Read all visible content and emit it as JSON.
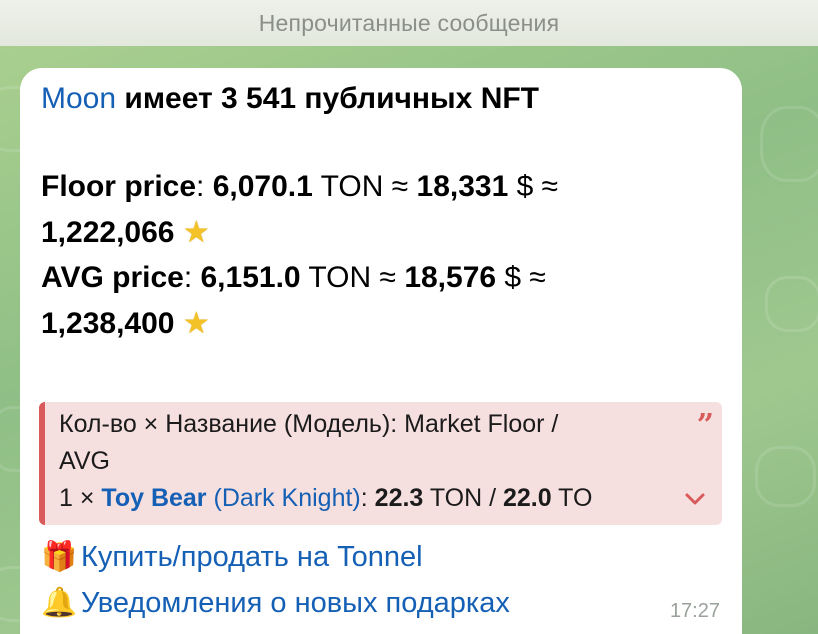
{
  "header": {
    "title": "Непрочитанные сообщения"
  },
  "message": {
    "line1": {
      "name": "Moon",
      "text": " имеет 3 541 публичных NFT"
    },
    "floor": {
      "label": "Floor price",
      "colon": ": ",
      "ton_value": "6,070.1",
      "ton_unit": " TON ≈ ",
      "usd_value": "18,331",
      "usd_unit": " $ ≈",
      "stars_value": "1,222,066"
    },
    "avg": {
      "label": "AVG price",
      "colon": ": ",
      "ton_value": "6,151.0",
      "ton_unit": " TON ≈ ",
      "usd_value": "18,576",
      "usd_unit": " $ ≈",
      "stars_value": "1,238,400"
    },
    "star_glyph": "★",
    "quote": {
      "header_line1": "Кол-во × Название (Модель): Market Floor /",
      "header_line2": "AVG",
      "item_count": "1 × ",
      "item_name": "Toy Bear",
      "item_model": " (Dark Knight)",
      "item_colon": ": ",
      "item_floor": "22.3",
      "item_sep": " TON / ",
      "item_avg": "22.0",
      "item_tail": " TO",
      "quote_mark": "”"
    },
    "buttons": [
      {
        "emoji": "🎁",
        "label": "Купить/продать на Tonnel"
      },
      {
        "emoji": "🔔",
        "label": "Уведомления о новых подарках"
      }
    ],
    "time": "17:27"
  },
  "colors": {
    "link": "#1560b5",
    "quote_accent": "#d85a5a",
    "quote_bg": "#f6dfdf",
    "bubble": "#ffffff"
  }
}
